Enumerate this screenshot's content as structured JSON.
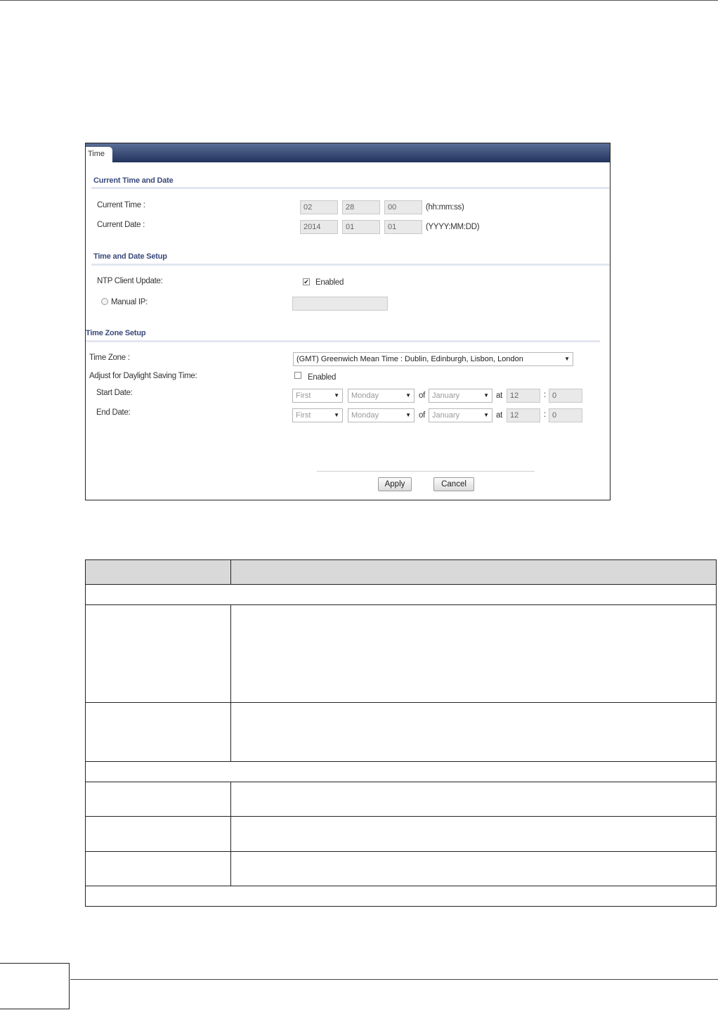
{
  "tab": {
    "label": "Time"
  },
  "sections": {
    "current": "Current Time and Date",
    "setup": "Time and Date Setup",
    "zone": "Time Zone Setup"
  },
  "current_time": {
    "label": "Current Time :",
    "hh": "02",
    "mm": "28",
    "ss": "00",
    "format": "(hh:mm:ss)"
  },
  "current_date": {
    "label": "Current Date :",
    "yyyy": "2014",
    "mm": "01",
    "dd": "01",
    "format": "(YYYY:MM:DD)"
  },
  "ntp": {
    "label": "NTP Client Update:",
    "enabled_label": "Enabled",
    "checked": true
  },
  "manual_ip": {
    "label": "Manual IP:",
    "value": ""
  },
  "time_zone": {
    "label": "Time Zone :",
    "value": "(GMT) Greenwich Mean Time : Dublin, Edinburgh, Lisbon, London"
  },
  "dst": {
    "label": "Adjust for Daylight Saving Time:",
    "enabled_label": "Enabled",
    "checked": false
  },
  "start_date": {
    "label": "Start Date:",
    "week": "First",
    "day": "Monday",
    "of": "of",
    "month": "January",
    "at": "at",
    "hour": "12",
    "colon": ":",
    "minute": "0"
  },
  "end_date": {
    "label": "End Date:",
    "week": "First",
    "day": "Monday",
    "of": "of",
    "month": "January",
    "at": "at",
    "hour": "12",
    "colon": ":",
    "minute": "0"
  },
  "buttons": {
    "apply": "Apply",
    "cancel": "Cancel"
  }
}
